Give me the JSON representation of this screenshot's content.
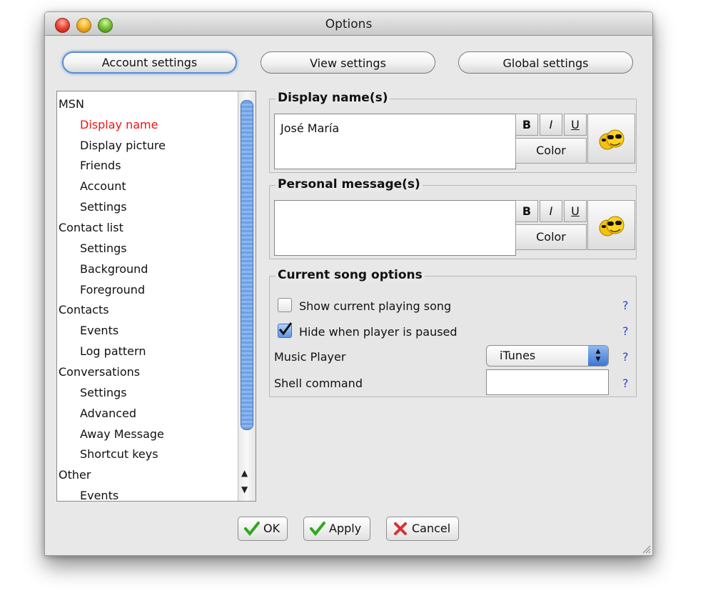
{
  "window": {
    "title": "Options"
  },
  "tabs": [
    {
      "label": "Account settings",
      "active": true
    },
    {
      "label": "View settings",
      "active": false
    },
    {
      "label": "Global settings",
      "active": false
    }
  ],
  "tree": {
    "items": [
      {
        "label": "MSN",
        "level": 0
      },
      {
        "label": "Display name",
        "level": 1,
        "selected": true
      },
      {
        "label": "Display picture",
        "level": 1
      },
      {
        "label": "Friends",
        "level": 1
      },
      {
        "label": "Account",
        "level": 1
      },
      {
        "label": "Settings",
        "level": 1
      },
      {
        "label": "Contact list",
        "level": 0
      },
      {
        "label": "Settings",
        "level": 1
      },
      {
        "label": "Background",
        "level": 1
      },
      {
        "label": "Foreground",
        "level": 1
      },
      {
        "label": "Contacts",
        "level": 0
      },
      {
        "label": "Events",
        "level": 1
      },
      {
        "label": "Log pattern",
        "level": 1
      },
      {
        "label": "Conversations",
        "level": 0
      },
      {
        "label": "Settings",
        "level": 1
      },
      {
        "label": "Advanced",
        "level": 1
      },
      {
        "label": "Away Message",
        "level": 1
      },
      {
        "label": "Shortcut keys",
        "level": 1
      },
      {
        "label": "Other",
        "level": 0
      },
      {
        "label": "Events",
        "level": 1
      }
    ],
    "selected_color": "#f31212"
  },
  "display_name": {
    "title": "Display name(s)",
    "value": "José María",
    "bold": "B",
    "italic": "I",
    "underline": "U",
    "color_label": "Color"
  },
  "personal_message": {
    "title": "Personal message(s)",
    "value": "",
    "bold": "B",
    "italic": "I",
    "underline": "U",
    "color_label": "Color"
  },
  "song_options": {
    "title": "Current song options",
    "show_song_label": "Show current playing song",
    "show_song_checked": false,
    "hide_paused_label": "Hide when player is paused",
    "hide_paused_checked": true,
    "music_player_label": "Music Player",
    "music_player_value": "iTunes",
    "shell_command_label": "Shell command",
    "shell_command_value": "",
    "help": "?"
  },
  "actions": {
    "ok": "OK",
    "apply": "Apply",
    "cancel": "Cancel"
  },
  "colors": {
    "accent": "#5a8fd2",
    "help": "#2b3fd8",
    "ok_check": "#2fa81b",
    "cancel_x": "#d8312f"
  }
}
